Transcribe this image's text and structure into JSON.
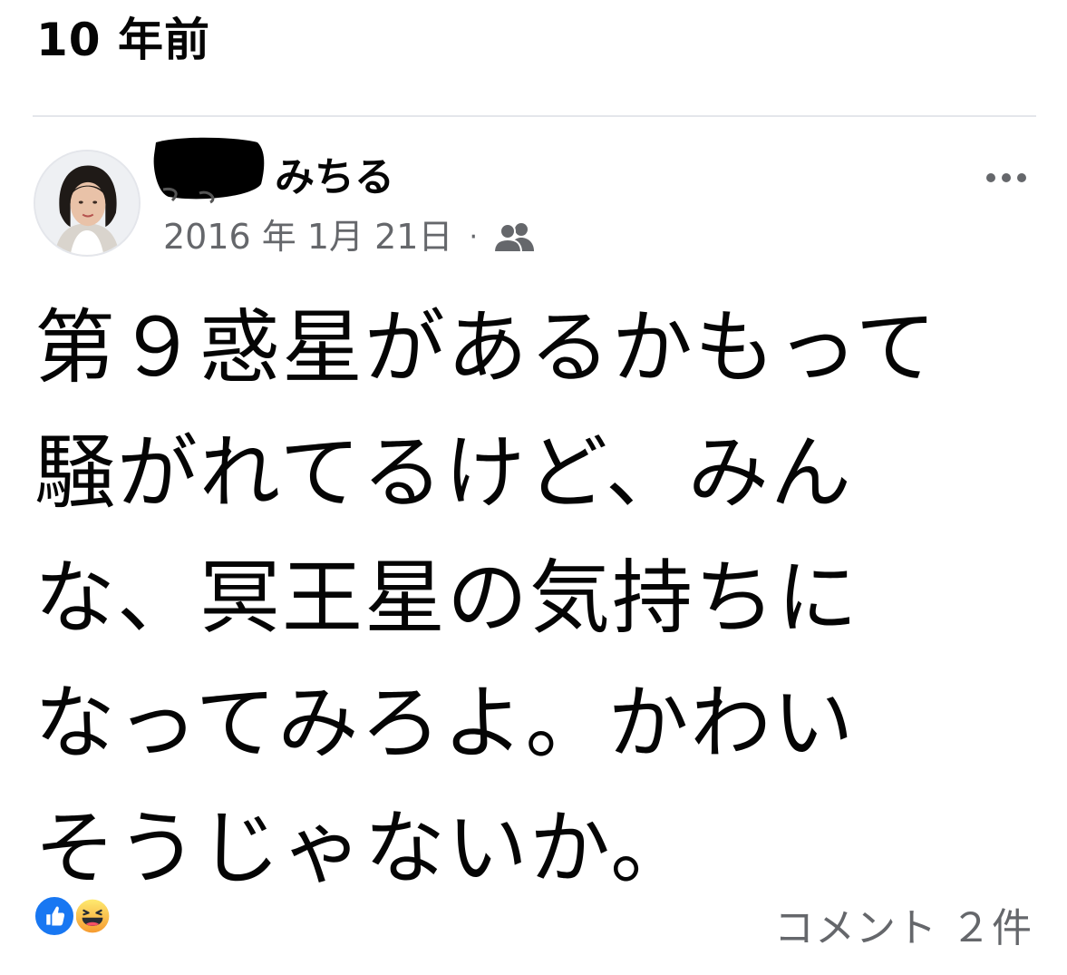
{
  "memory_header": {
    "title": "10 年前"
  },
  "post": {
    "author_name": "みちる",
    "date": "2016 年 1月 21日",
    "separator": "·",
    "audience_icon": "friends-icon",
    "text": "第９惑星があるかもって\n騒がれてるけど、みん\nな、冥王星の気持ちに\nなってみろよ。かわい\nそうじゃないか。",
    "reactions": [
      "like-icon",
      "haha-icon"
    ],
    "comment_count": "コメント ２件"
  },
  "colors": {
    "secondary_text": "#65676b",
    "like_blue": "#1877f2",
    "divider": "#e4e6eb"
  }
}
